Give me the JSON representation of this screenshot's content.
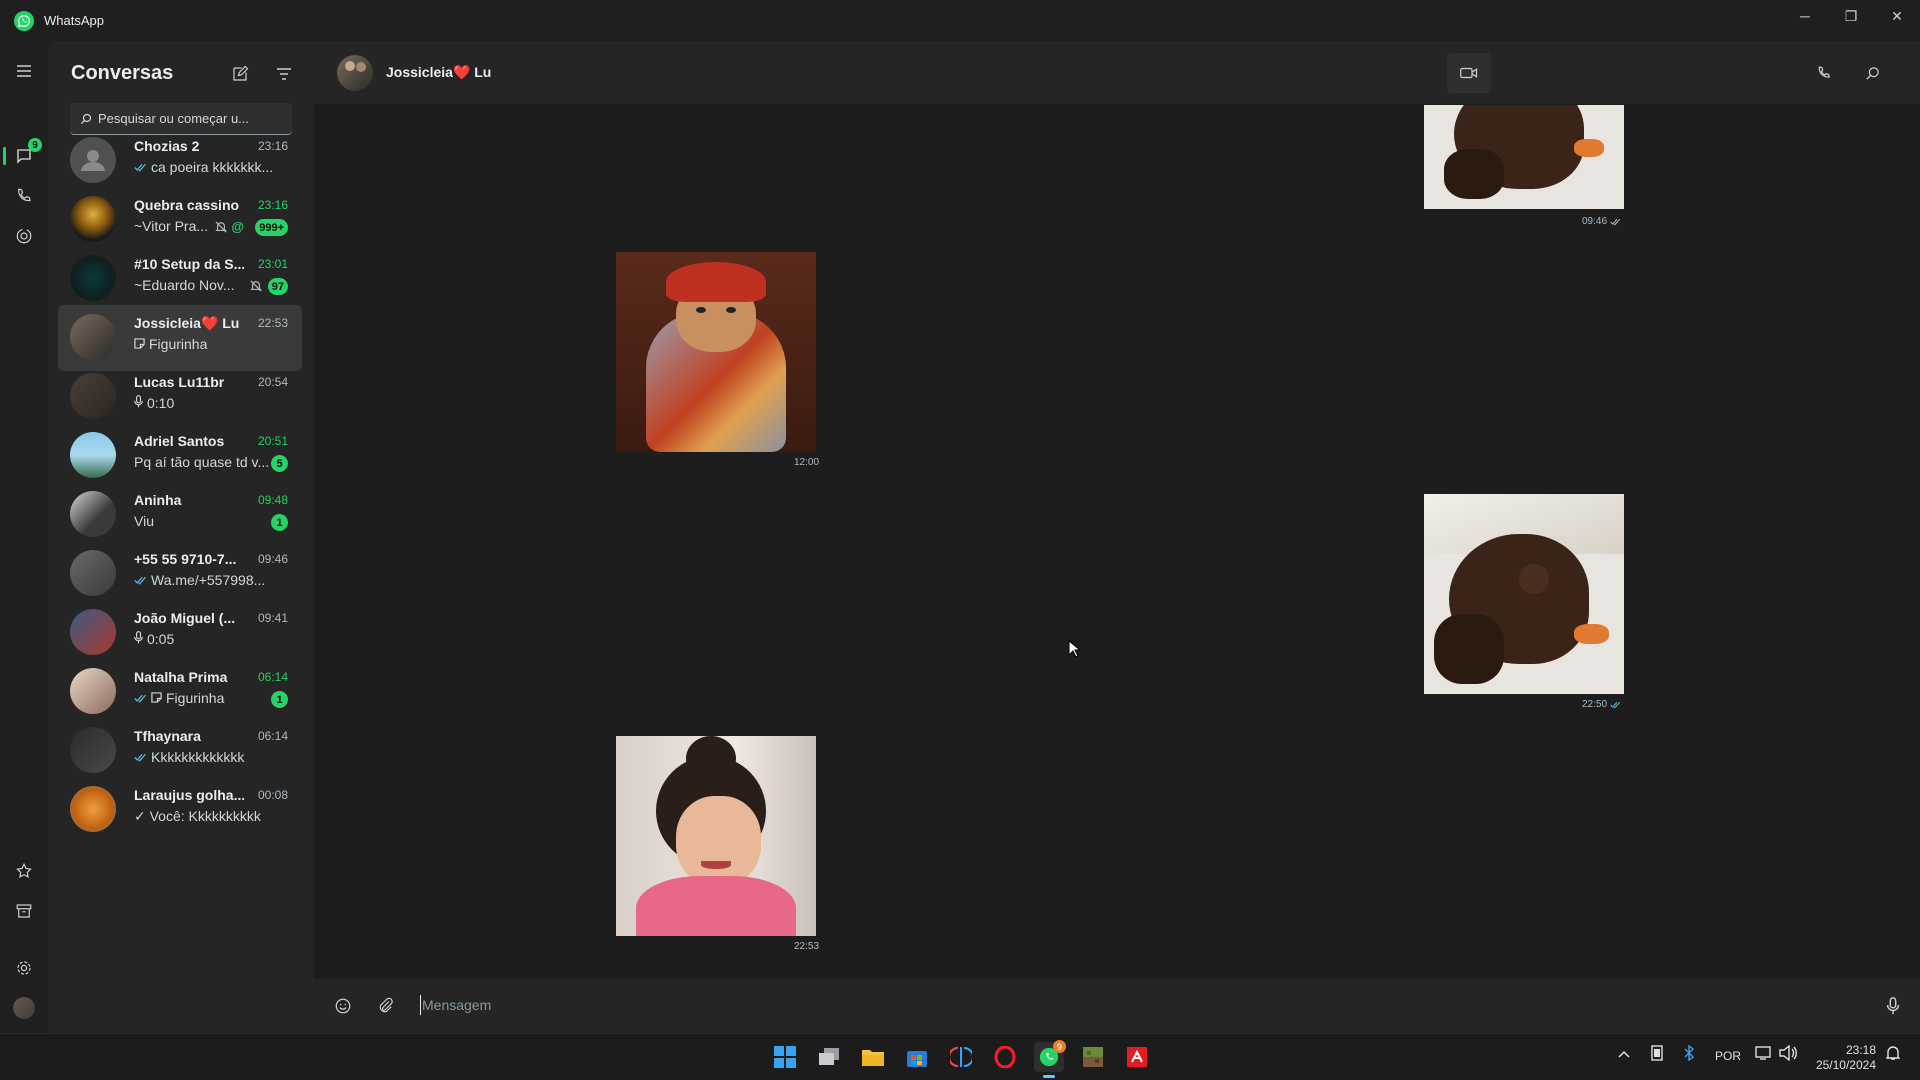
{
  "window": {
    "title": "WhatsApp",
    "controls": [
      "minimize",
      "restore",
      "close"
    ]
  },
  "rail": {
    "chats_badge": "9"
  },
  "chatlist": {
    "heading": "Conversas",
    "search_placeholder": "Pesquisar ou começar u...",
    "chats": [
      {
        "name": "Chozias 2",
        "time": "23:16",
        "time_green": false,
        "preview": "ca poeira kkkkkkk...",
        "ticks": true,
        "unread": "",
        "avatar": "default"
      },
      {
        "name": "Quebra cassino",
        "time": "23:16",
        "time_green": true,
        "preview": "~Vitor Pra...",
        "ticks": false,
        "unread": "999+",
        "muted": true,
        "mention": "@",
        "avatar": "group"
      },
      {
        "name": "#10 Setup da S...",
        "time": "23:01",
        "time_green": true,
        "preview": "~Eduardo Nov...",
        "ticks": false,
        "unread": "97",
        "muted": true,
        "avatar": "setup"
      },
      {
        "name": "Jossicleia❤️ Lu",
        "time": "22:53",
        "time_green": false,
        "preview": "Figurinha",
        "sticker_icon": true,
        "ticks": false,
        "unread": "",
        "active": true,
        "avatar": "couple"
      },
      {
        "name": "Lucas Lu11br",
        "time": "20:54",
        "time_green": false,
        "preview": "0:10",
        "mic": true,
        "ticks": false,
        "unread": "",
        "avatar": "person"
      },
      {
        "name": "Adriel Santos",
        "time": "20:51",
        "time_green": true,
        "preview": "Pq aí tão quase td v...",
        "ticks": false,
        "unread": "5",
        "avatar": "beach"
      },
      {
        "name": "Aninha",
        "time": "09:48",
        "time_green": true,
        "preview": "Viu",
        "ticks": false,
        "unread": "1",
        "avatar": "woman"
      },
      {
        "name": "+55 55 9710-7...",
        "time": "09:46",
        "time_green": false,
        "preview": "Wa.me/+557998...",
        "ticks": true,
        "unread": "",
        "avatar": "car"
      },
      {
        "name": "João Miguel (...",
        "time": "09:41",
        "time_green": false,
        "preview": "0:05",
        "mic": true,
        "ticks": false,
        "unread": "",
        "avatar": "person2"
      },
      {
        "name": "Natalha Prima",
        "time": "06:14",
        "time_green": true,
        "preview": "Figurinha",
        "sticker_icon": true,
        "ticks": true,
        "unread": "1",
        "avatar": "family"
      },
      {
        "name": "Tfhaynara",
        "time": "06:14",
        "time_green": false,
        "preview": "Kkkkkkkkkkkkk",
        "ticks": true,
        "unread": "",
        "avatar": "dark"
      },
      {
        "name": "Laraujus golha...",
        "time": "00:08",
        "time_green": false,
        "preview": "✓ Você: Kkkkkkkkkk",
        "ticks": false,
        "unread": "",
        "avatar": "orange"
      }
    ]
  },
  "conversation": {
    "contact": "Jossicleia❤️ Lu",
    "messages": [
      {
        "side": "out",
        "sticker": "rat",
        "time": "09:46"
      },
      {
        "side": "in",
        "sticker": "dog",
        "time": "12:00"
      },
      {
        "side": "out",
        "sticker": "rat",
        "time": "22:50"
      },
      {
        "side": "in",
        "sticker": "girl",
        "time": "22:53"
      }
    ],
    "composer_placeholder": "Mensagem"
  },
  "taskbar": {
    "lang": "POR",
    "time": "23:18",
    "date": "25/10/2024",
    "whatsapp_badge": "9"
  },
  "colors": {
    "accent": "#25d366",
    "bg": "#1f1f1f",
    "panel": "#252525"
  }
}
